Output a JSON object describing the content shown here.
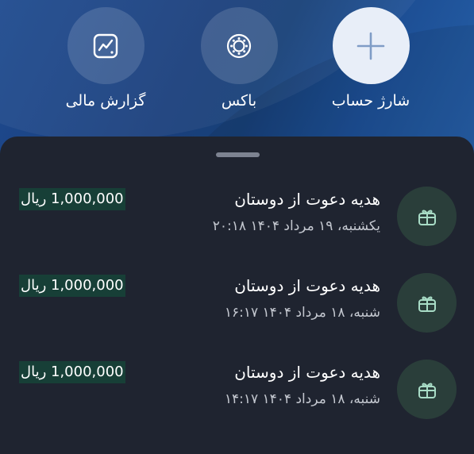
{
  "actions": [
    {
      "label": "گزارش مالی",
      "icon": "chart-icon"
    },
    {
      "label": "باکس",
      "icon": "box-icon"
    },
    {
      "label": "شارژ حساب",
      "icon": "plus-icon"
    }
  ],
  "transactions": [
    {
      "title": "هدیه دعوت از دوستان",
      "date": "یکشنبه، ۱۹ مرداد ۱۴۰۴ ۲۰:۱۸",
      "amount": "1,000,000 ریال",
      "icon": "gift-icon"
    },
    {
      "title": "هدیه دعوت از دوستان",
      "date": "شنبه، ۱۸ مرداد ۱۴۰۴ ۱۶:۱۷",
      "amount": "1,000,000 ریال",
      "icon": "gift-icon"
    },
    {
      "title": "هدیه دعوت از دوستان",
      "date": "شنبه، ۱۸ مرداد ۱۴۰۴ ۱۴:۱۷",
      "amount": "1,000,000 ریال",
      "icon": "gift-icon"
    }
  ],
  "colors": {
    "header_blue": "#1a3f7c",
    "sheet_bg": "#1f2430",
    "amount_highlight": "#173f37",
    "gift_circle": "#2a3e3a",
    "gift_icon": "#a8dcc6"
  }
}
